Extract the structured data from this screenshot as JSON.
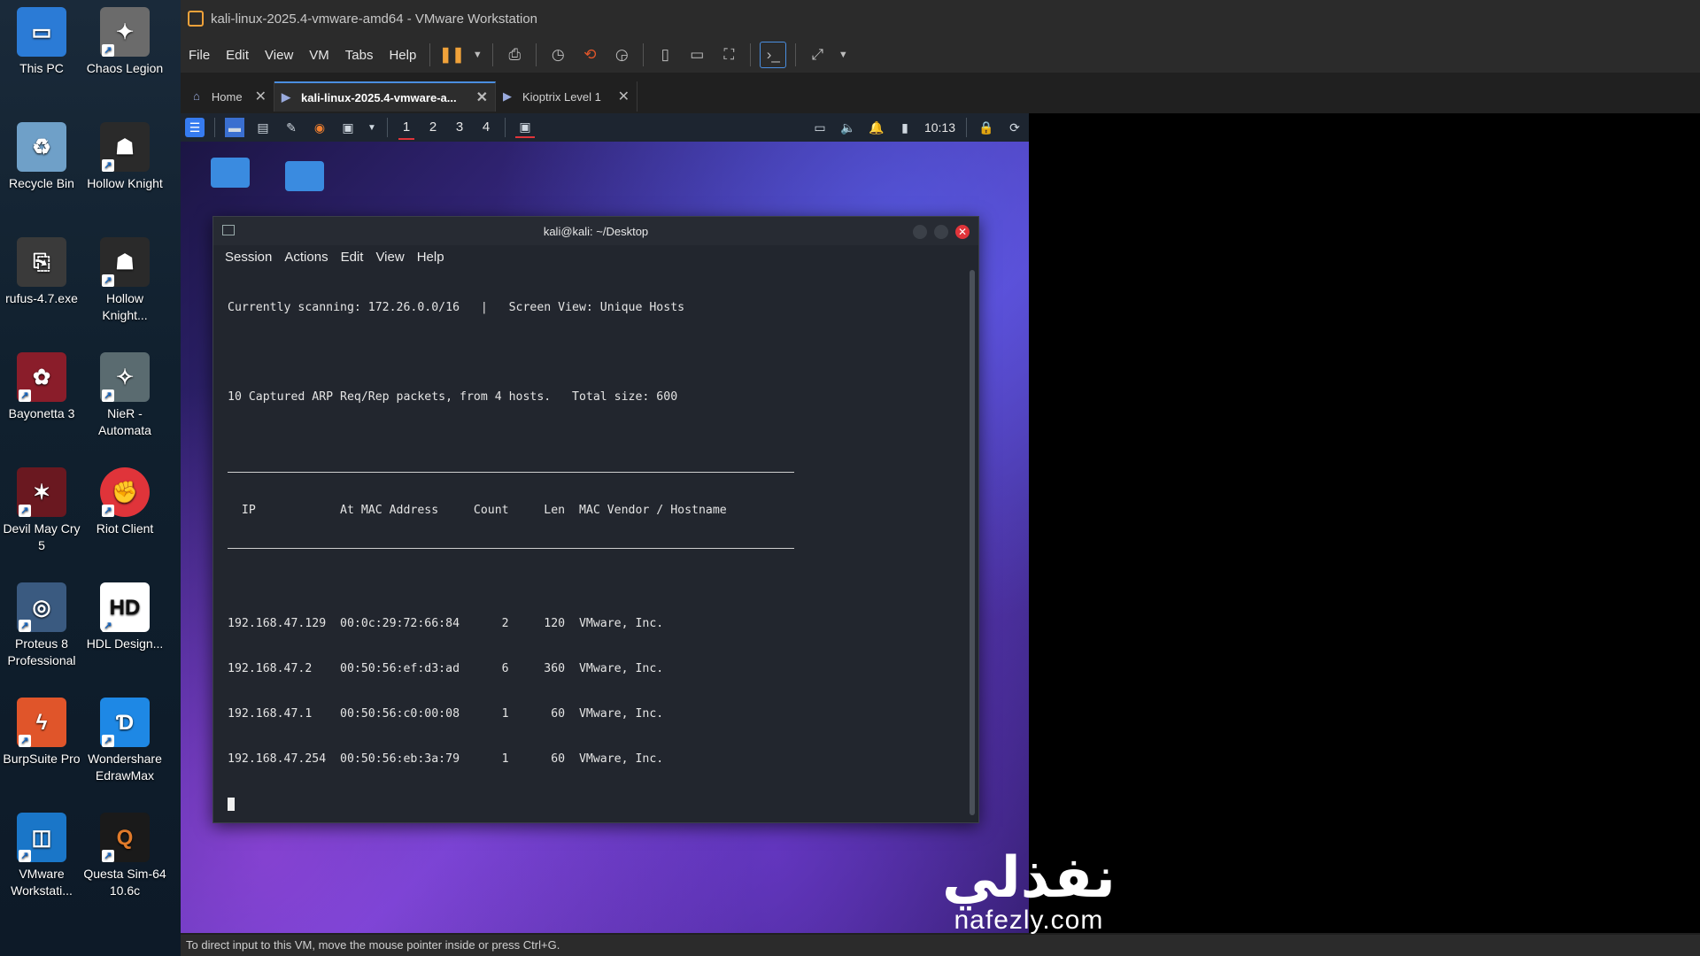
{
  "desktop": {
    "icons": [
      {
        "label": "This PC",
        "color": "#2b7bd6",
        "glyph": "▭"
      },
      {
        "label": "Chaos Legion",
        "color": "#6b6b6b",
        "glyph": "✦"
      },
      {
        "label": "Recycle Bin",
        "color": "#6fa0c8",
        "glyph": "♻"
      },
      {
        "label": "Hollow Knight",
        "color": "#2a2a2a",
        "glyph": "☗"
      },
      {
        "label": "rufus-4.7.exe",
        "color": "#3a3a3a",
        "glyph": "⎘"
      },
      {
        "label": "Hollow Knight...",
        "color": "#2a2a2a",
        "glyph": "☗"
      },
      {
        "label": "Bayonetta 3",
        "color": "#8a1d2a",
        "glyph": "✿"
      },
      {
        "label": "NieR - Automata",
        "color": "#5a6b70",
        "glyph": "✧"
      },
      {
        "label": "Devil May Cry 5",
        "color": "#6a1820",
        "glyph": "✶"
      },
      {
        "label": "Riot Client",
        "color": "#e0343a",
        "glyph": "✊"
      },
      {
        "label": "Proteus 8 Professional",
        "color": "#3a5a80",
        "glyph": "◎"
      },
      {
        "label": "HDL Design...",
        "color": "#ffffff",
        "glyph": "HD"
      },
      {
        "label": "BurpSuite Pro",
        "color": "#e0552a",
        "glyph": "ϟ"
      },
      {
        "label": "Wondershare EdrawMax",
        "color": "#1e88e5",
        "glyph": "Ɗ"
      },
      {
        "label": "VMware Workstati...",
        "color": "#1a76c8",
        "glyph": "◫"
      },
      {
        "label": "Questa Sim-64 10.6c",
        "color": "#1a1a1a",
        "glyph": "Q"
      }
    ]
  },
  "vmware": {
    "title": "kali-linux-2025.4-vmware-amd64 - VMware Workstation",
    "menu": [
      "File",
      "Edit",
      "View",
      "VM",
      "Tabs",
      "Help"
    ],
    "tabs": [
      {
        "label": "Home",
        "active": false
      },
      {
        "label": "kali-linux-2025.4-vmware-a...",
        "active": true
      },
      {
        "label": "Kioptrix Level 1",
        "active": false
      }
    ],
    "status": "To direct input to this VM, move the mouse pointer inside or press Ctrl+G."
  },
  "kali": {
    "workspaces": [
      "1",
      "2",
      "3",
      "4"
    ],
    "clock": "10:13"
  },
  "terminal": {
    "title": "kali@kali: ~/Desktop",
    "menu": [
      "Session",
      "Actions",
      "Edit",
      "View",
      "Help"
    ],
    "line1": "Currently scanning: 172.26.0.0/16   |   Screen View: Unique Hosts",
    "line2": "10 Captured ARP Req/Rep packets, from 4 hosts.   Total size: 600",
    "header": "  IP            At MAC Address     Count     Len  MAC Vendor / Hostname",
    "rows": [
      "192.168.47.129  00:0c:29:72:66:84      2     120  VMware, Inc.",
      "192.168.47.2    00:50:56:ef:d3:ad      6     360  VMware, Inc.",
      "192.168.47.1    00:50:56:c0:00:08      1      60  VMware, Inc.",
      "192.168.47.254  00:50:56:eb:3a:79      1      60  VMware, Inc."
    ]
  },
  "watermark": {
    "arabic": "نفذلي",
    "latin": "nafezly.com"
  }
}
